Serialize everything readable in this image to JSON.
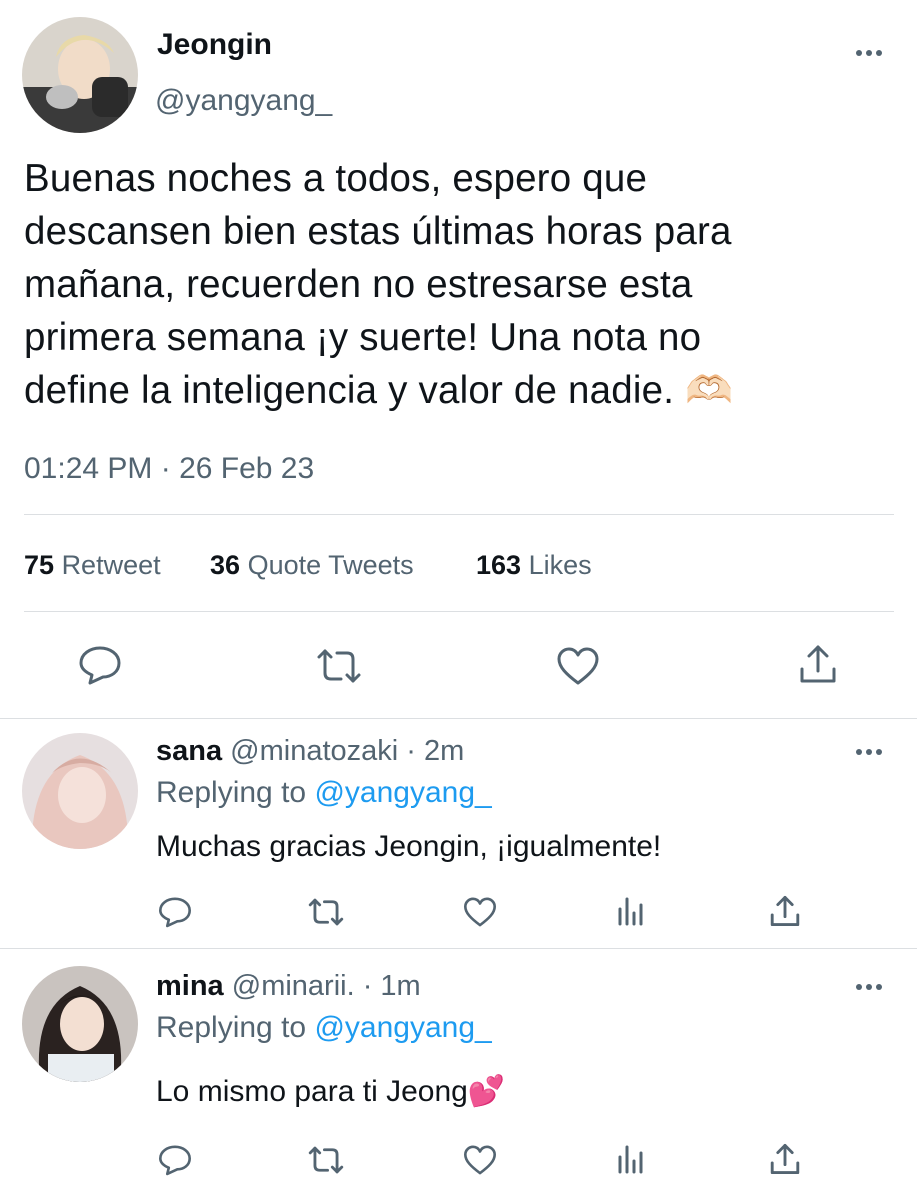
{
  "tweet": {
    "author_name": "Jeongin",
    "author_handle": "@yangyang_",
    "text_lines": [
      "Buenas noches a todos, espero que",
      "descansen bien estas últimas horas para",
      "mañana, recuerden no estresarse esta",
      "primera semana ¡y suerte! Una nota no",
      "define la inteligencia y valor de nadie. 🫶🏻"
    ],
    "timestamp": "01:24 PM · 26 Feb 23",
    "stats": {
      "retweets_count": "75",
      "retweets_label": "Retweet",
      "quotes_count": "36",
      "quotes_label": "Quote Tweets",
      "likes_count": "163",
      "likes_label": "Likes"
    }
  },
  "replies": [
    {
      "name": "sana",
      "handle_time": "@minatozaki · 2m",
      "replying_prefix": "Replying to",
      "replying_to": "@yangyang_",
      "text": "Muchas gracias Jeongin, ¡igualmente!"
    },
    {
      "name": "mina",
      "handle_time": "@minarii. · 1m",
      "replying_prefix": "Replying to",
      "replying_to": "@yangyang_",
      "text": "Lo mismo para ti Jeong💕"
    }
  ],
  "icons": {
    "action_bar": [
      "reply-icon",
      "retweet-icon",
      "like-icon",
      "share-icon"
    ],
    "reply_action_bar": [
      "reply-icon",
      "retweet-icon",
      "like-icon",
      "analytics-icon",
      "share-icon"
    ]
  },
  "colors": {
    "text_primary": "#0f1419",
    "text_secondary": "#536471",
    "link": "#1d9bf0",
    "divider": "#dcdfe2"
  }
}
